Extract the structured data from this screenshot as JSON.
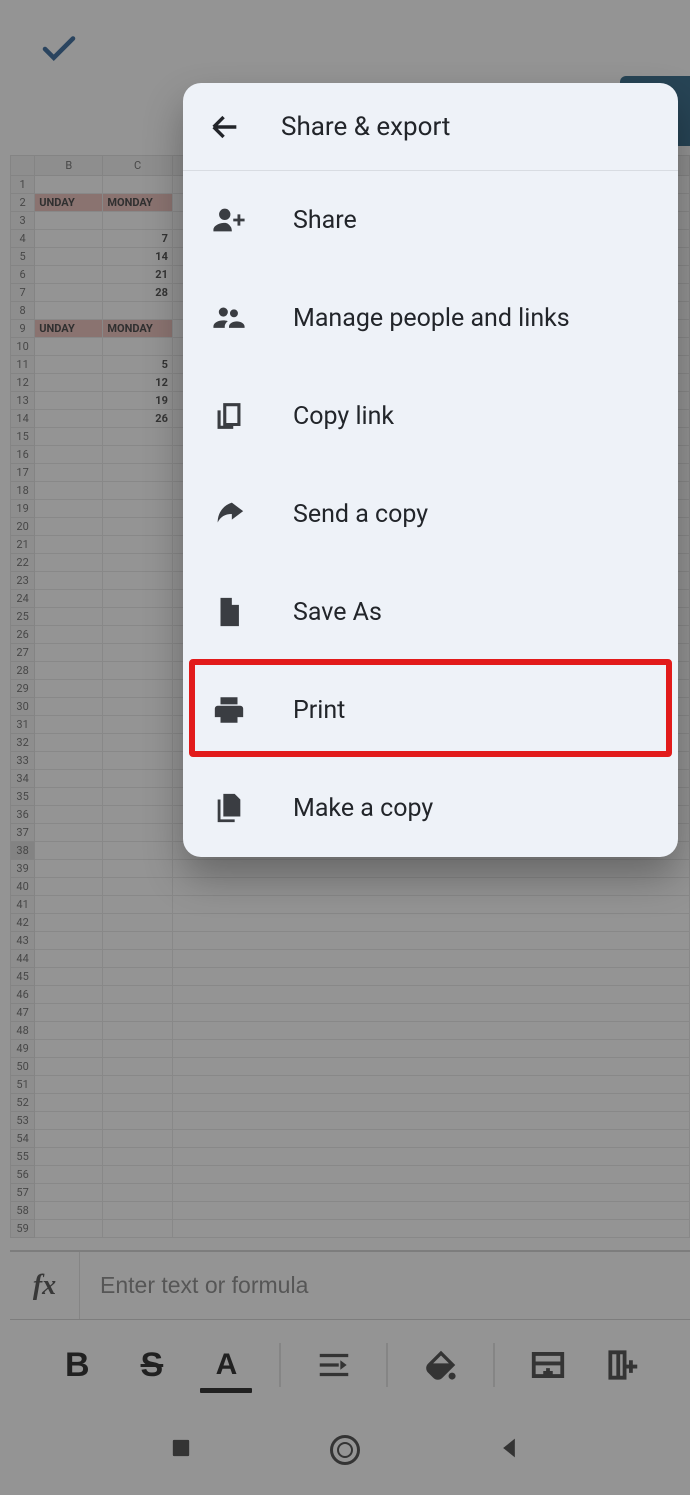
{
  "topbar": {
    "check_icon": "check-icon"
  },
  "menu": {
    "title": "Share & export",
    "items": [
      {
        "id": "share",
        "label": "Share",
        "icon": "person-add-icon"
      },
      {
        "id": "manage",
        "label": "Manage people and links",
        "icon": "people-icon"
      },
      {
        "id": "copylink",
        "label": "Copy link",
        "icon": "copy-link-icon"
      },
      {
        "id": "sendcopy",
        "label": "Send a copy",
        "icon": "arrow-share-icon"
      },
      {
        "id": "saveas",
        "label": "Save As",
        "icon": "file-icon"
      },
      {
        "id": "print",
        "label": "Print",
        "icon": "print-icon",
        "highlight": true
      },
      {
        "id": "makecopy",
        "label": "Make a copy",
        "icon": "file-copy-icon"
      }
    ]
  },
  "sheet": {
    "columns": [
      "B",
      "C"
    ],
    "rows": [
      {
        "n": 1,
        "cells": [
          "",
          ""
        ]
      },
      {
        "n": 2,
        "cells": [
          "UNDAY",
          "MONDAY"
        ],
        "hdr": true
      },
      {
        "n": 3,
        "cells": [
          "",
          ""
        ]
      },
      {
        "n": 4,
        "cells": [
          "",
          "7"
        ],
        "num": true
      },
      {
        "n": 5,
        "cells": [
          "",
          "14"
        ],
        "num": true
      },
      {
        "n": 6,
        "cells": [
          "",
          "21"
        ],
        "num": true
      },
      {
        "n": 7,
        "cells": [
          "",
          "28"
        ],
        "num": true
      },
      {
        "n": 8,
        "cells": [
          "",
          ""
        ]
      },
      {
        "n": 9,
        "cells": [
          "UNDAY",
          "MONDAY"
        ],
        "hdr": true
      },
      {
        "n": 10,
        "cells": [
          "",
          ""
        ]
      },
      {
        "n": 11,
        "cells": [
          "",
          "5"
        ],
        "num": true
      },
      {
        "n": 12,
        "cells": [
          "",
          "12"
        ],
        "num": true
      },
      {
        "n": 13,
        "cells": [
          "",
          "19"
        ],
        "num": true
      },
      {
        "n": 14,
        "cells": [
          "",
          "26"
        ],
        "num": true
      }
    ],
    "selectedRow": 38,
    "maxRow": 59
  },
  "formula": {
    "fx": "fx",
    "placeholder": "Enter text or formula"
  },
  "toolbar": {
    "bold": "B",
    "strike": "S",
    "textcolor": "A"
  },
  "annotation": {
    "target": "print",
    "color": "#e21b1b"
  }
}
